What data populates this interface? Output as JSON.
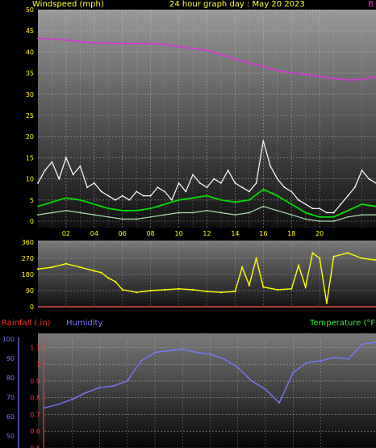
{
  "header": {
    "left_title": "Windspeed (mph)",
    "center_title": "24 hour graph day : May 20 2023",
    "right_mark": "B"
  },
  "colors": {
    "background": "#000000",
    "wind_gust": "#ffffff",
    "wind_avg": "#00dd00",
    "wind_low": "#aaddaa",
    "barometer": "#dd33dd",
    "direction": "#ffff00",
    "humidity": "#7777ff",
    "rainfall": "#ff3333",
    "temperature_label": "#33ee33",
    "title": "#ffff33",
    "axis_text": "#ffff00"
  },
  "bottom_labels": {
    "rainfall": "Rainfall (.in)",
    "humidity": "Humidity",
    "temperature": "Temperature (°F)"
  },
  "chart_data": [
    {
      "type": "line",
      "name": "windspeed",
      "title": "Windspeed (mph)",
      "ylim": [
        0,
        50
      ],
      "yticks": [
        "0",
        "5",
        "10",
        "15",
        "20",
        "25",
        "30",
        "35",
        "40",
        "45",
        "50"
      ],
      "xticks": [
        "02",
        "04",
        "06",
        "08",
        "10",
        "12",
        "14",
        "16",
        "18",
        "20"
      ],
      "xlim": [
        0,
        24
      ],
      "series": [
        {
          "id": "barometer_trace",
          "x": [
            0,
            1,
            2,
            3,
            4,
            5,
            6,
            7,
            8,
            9,
            10,
            11,
            12,
            13,
            14,
            15,
            16,
            17,
            18,
            19,
            20,
            21,
            22,
            23,
            24
          ],
          "values": [
            43.2,
            43.1,
            42.8,
            42.4,
            42.2,
            42.1,
            42.0,
            42.0,
            42.0,
            41.8,
            41.3,
            40.8,
            40.4,
            39.4,
            38.3,
            37.4,
            36.6,
            35.6,
            35.1,
            34.7,
            34.2,
            33.7,
            33.4,
            33.5,
            34.2
          ]
        },
        {
          "id": "gust",
          "x": [
            0,
            0.5,
            1,
            1.5,
            2,
            2.5,
            3,
            3.5,
            4,
            4.5,
            5,
            5.5,
            6,
            6.5,
            7,
            7.5,
            8,
            8.5,
            9,
            9.5,
            10,
            10.5,
            11,
            11.5,
            12,
            12.5,
            13,
            13.5,
            14,
            14.5,
            15,
            15.5,
            16,
            16.5,
            17,
            17.5,
            18,
            18.5,
            19,
            19.5,
            20,
            20.5,
            21,
            21.5,
            22,
            22.5,
            23,
            23.5,
            24
          ],
          "values": [
            9,
            12,
            14,
            10,
            15,
            11,
            13,
            8,
            9,
            7,
            6,
            5,
            6,
            5,
            7,
            6,
            6,
            8,
            7,
            5,
            9,
            7,
            11,
            9,
            8,
            10,
            9,
            12,
            9,
            8,
            7,
            9,
            19,
            13,
            10,
            8,
            7,
            5,
            4,
            3,
            3,
            2,
            2,
            4,
            6,
            8,
            12,
            10,
            9
          ]
        },
        {
          "id": "average",
          "x": [
            0,
            1,
            2,
            3,
            4,
            5,
            6,
            7,
            8,
            9,
            10,
            11,
            12,
            13,
            14,
            15,
            16,
            17,
            18,
            19,
            20,
            21,
            22,
            23,
            24
          ],
          "values": [
            3.5,
            4.5,
            5.5,
            5,
            4,
            3,
            2.5,
            2.5,
            3,
            4,
            5,
            5.5,
            6,
            5,
            4.5,
            5,
            7.5,
            6,
            4,
            2,
            1,
            1,
            2.5,
            4,
            3.5
          ]
        },
        {
          "id": "lull",
          "x": [
            0,
            1,
            2,
            3,
            4,
            5,
            6,
            7,
            8,
            9,
            10,
            11,
            12,
            13,
            14,
            15,
            16,
            17,
            18,
            19,
            20,
            21,
            22,
            23,
            24
          ],
          "values": [
            1.5,
            2,
            2.5,
            2,
            1.5,
            1,
            0.5,
            0.5,
            1,
            1.5,
            2,
            2,
            2.5,
            2,
            1.5,
            2,
            3.5,
            2.5,
            1.5,
            0.5,
            0,
            0,
            1,
            1.5,
            1.5
          ]
        }
      ]
    },
    {
      "type": "scatter",
      "name": "wind_direction",
      "ylim": [
        0,
        360
      ],
      "yticks": [
        "0",
        "90",
        "180",
        "270",
        "360"
      ],
      "xlim": [
        0,
        24
      ],
      "x": [
        0,
        1,
        2,
        3,
        4,
        4.5,
        5,
        5.5,
        6,
        7,
        8,
        9,
        10,
        11,
        12,
        13,
        14,
        14.5,
        15,
        15.5,
        16,
        17,
        18,
        18.5,
        19,
        19.5,
        20,
        20.5,
        21,
        22,
        23,
        24
      ],
      "y": [
        210,
        220,
        240,
        220,
        200,
        190,
        160,
        140,
        95,
        80,
        90,
        95,
        100,
        95,
        85,
        80,
        85,
        220,
        120,
        270,
        110,
        95,
        100,
        230,
        110,
        300,
        270,
        20,
        280,
        300,
        270,
        260
      ]
    },
    {
      "type": "line",
      "name": "humidity",
      "ylim": [
        0.5,
        1.15
      ],
      "yticks_left": [
        "50",
        "60",
        "70",
        "80",
        "90",
        "100"
      ],
      "yticks_right": [
        "0.5",
        "0.6",
        "0.7",
        "0.8",
        "0.9",
        "1",
        "1.1"
      ],
      "xlim": [
        0,
        24
      ],
      "x": [
        0,
        1,
        2,
        3,
        4,
        5,
        6,
        7,
        8,
        9,
        10,
        11,
        12,
        13,
        14,
        15,
        16,
        17,
        18,
        19,
        20,
        21,
        22,
        23,
        24
      ],
      "values": [
        0.74,
        0.76,
        0.79,
        0.83,
        0.86,
        0.87,
        0.9,
        1.02,
        1.07,
        1.08,
        1.09,
        1.07,
        1.06,
        1.03,
        0.98,
        0.9,
        0.85,
        0.77,
        0.95,
        1.01,
        1.02,
        1.04,
        1.03,
        1.12,
        1.13
      ]
    }
  ]
}
